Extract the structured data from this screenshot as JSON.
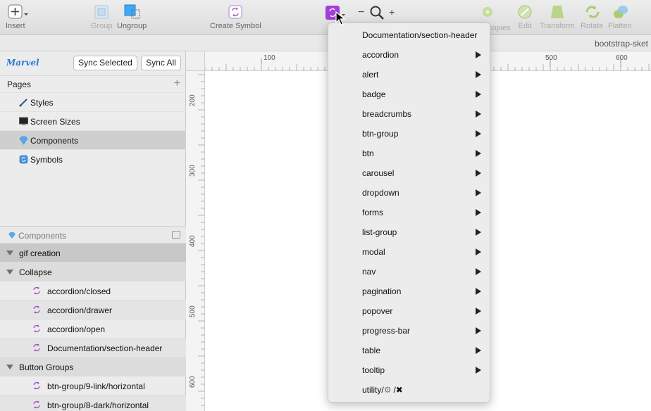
{
  "toolbar": {
    "insert": "Insert",
    "group": "Group",
    "ungroup": "Ungroup",
    "create_symbol": "Create Symbol",
    "symbols_short": "S",
    "zoom_minus": "−",
    "zoom_plus": "+",
    "copies": "copies",
    "edit": "Edit",
    "transform": "Transform",
    "rotate": "Rotate",
    "flatten": "Flatten"
  },
  "document": {
    "title": "bootstrap-sket"
  },
  "sidebar": {
    "logo": "Marvel",
    "sync_selected": "Sync Selected",
    "sync_all": "Sync All",
    "pages_label": "Pages",
    "pages": [
      {
        "label": "Styles",
        "icon": "pencil-icon"
      },
      {
        "label": "Screen Sizes",
        "icon": "monitor-icon"
      },
      {
        "label": "Components",
        "icon": "gem-icon",
        "selected": true
      },
      {
        "label": "Symbols",
        "icon": "symbol-icon"
      }
    ],
    "layers_label": "Components",
    "layers": [
      {
        "label": "gif creation",
        "type": "group"
      },
      {
        "label": "Collapse",
        "type": "group"
      },
      {
        "label": "accordion/closed",
        "type": "symbol"
      },
      {
        "label": "accordion/drawer",
        "type": "symbol"
      },
      {
        "label": "accordion/open",
        "type": "symbol"
      },
      {
        "label": "Documentation/section-header",
        "type": "symbol"
      },
      {
        "label": "Button Groups",
        "type": "group"
      },
      {
        "label": "btn-group/9-link/horizontal",
        "type": "symbol"
      },
      {
        "label": "btn-group/8-dark/horizontal",
        "type": "symbol"
      }
    ]
  },
  "rulers": {
    "h": [
      "100",
      "500",
      "600"
    ],
    "v": [
      "200",
      "300",
      "400",
      "500",
      "600"
    ]
  },
  "menu": {
    "items": [
      {
        "label": "Documentation/section-header",
        "submenu": false
      },
      {
        "label": "accordion",
        "submenu": true
      },
      {
        "label": "alert",
        "submenu": true
      },
      {
        "label": "badge",
        "submenu": true
      },
      {
        "label": "breadcrumbs",
        "submenu": true
      },
      {
        "label": "btn-group",
        "submenu": true
      },
      {
        "label": "btn",
        "submenu": true
      },
      {
        "label": "carousel",
        "submenu": true
      },
      {
        "label": "dropdown",
        "submenu": true
      },
      {
        "label": "forms",
        "submenu": true
      },
      {
        "label": "list-group",
        "submenu": true
      },
      {
        "label": "modal",
        "submenu": true
      },
      {
        "label": "nav",
        "submenu": true
      },
      {
        "label": "pagination",
        "submenu": true
      },
      {
        "label": "popover",
        "submenu": true
      },
      {
        "label": "progress-bar",
        "submenu": true
      },
      {
        "label": "table",
        "submenu": true
      },
      {
        "label": "tooltip",
        "submenu": true
      }
    ],
    "utility": {
      "prefix": "utility/",
      "slash": "/",
      "gear": "⚙",
      "cross": "✖"
    }
  },
  "colors": {
    "accent": "#a23fd6",
    "blue": "#2c7ad6",
    "green": "#8bc34a"
  }
}
